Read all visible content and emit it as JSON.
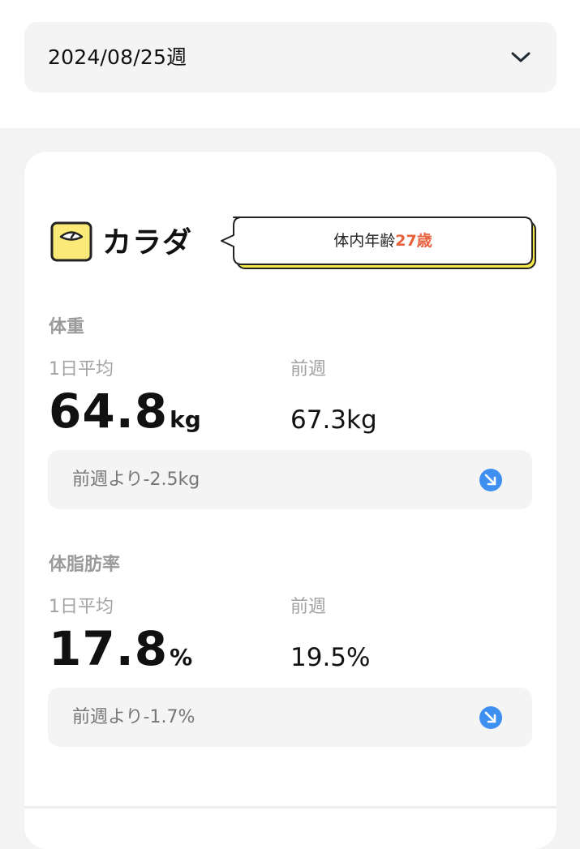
{
  "week_selector": {
    "label": "2024/08/25週",
    "icon": "chevron-down-icon"
  },
  "body_card": {
    "icon": "scale-icon",
    "title": "カラダ",
    "body_age": {
      "label": "体内年齢",
      "value": "27歳",
      "value_color": "#e8603c",
      "bubble_accent_color": "#f5e84a"
    },
    "weight": {
      "title": "体重",
      "avg_label": "1日平均",
      "avg_value": "64.8",
      "avg_unit": "kg",
      "prev_label": "前週",
      "prev_value": "67.3kg",
      "diff_text": "前週より-2.5kg",
      "diff_icon": "arrow-down-right-icon"
    },
    "body_fat": {
      "title": "体脂肪率",
      "avg_label": "1日平均",
      "avg_value": "17.8",
      "avg_unit": "%",
      "prev_label": "前週",
      "prev_value": "19.5%",
      "diff_text": "前週より-1.7%",
      "diff_icon": "arrow-down-right-icon"
    }
  },
  "colors": {
    "accent_blue": "#3d8ff0",
    "icon_yellow": "#fbe978",
    "background": "#f3f3f3"
  }
}
